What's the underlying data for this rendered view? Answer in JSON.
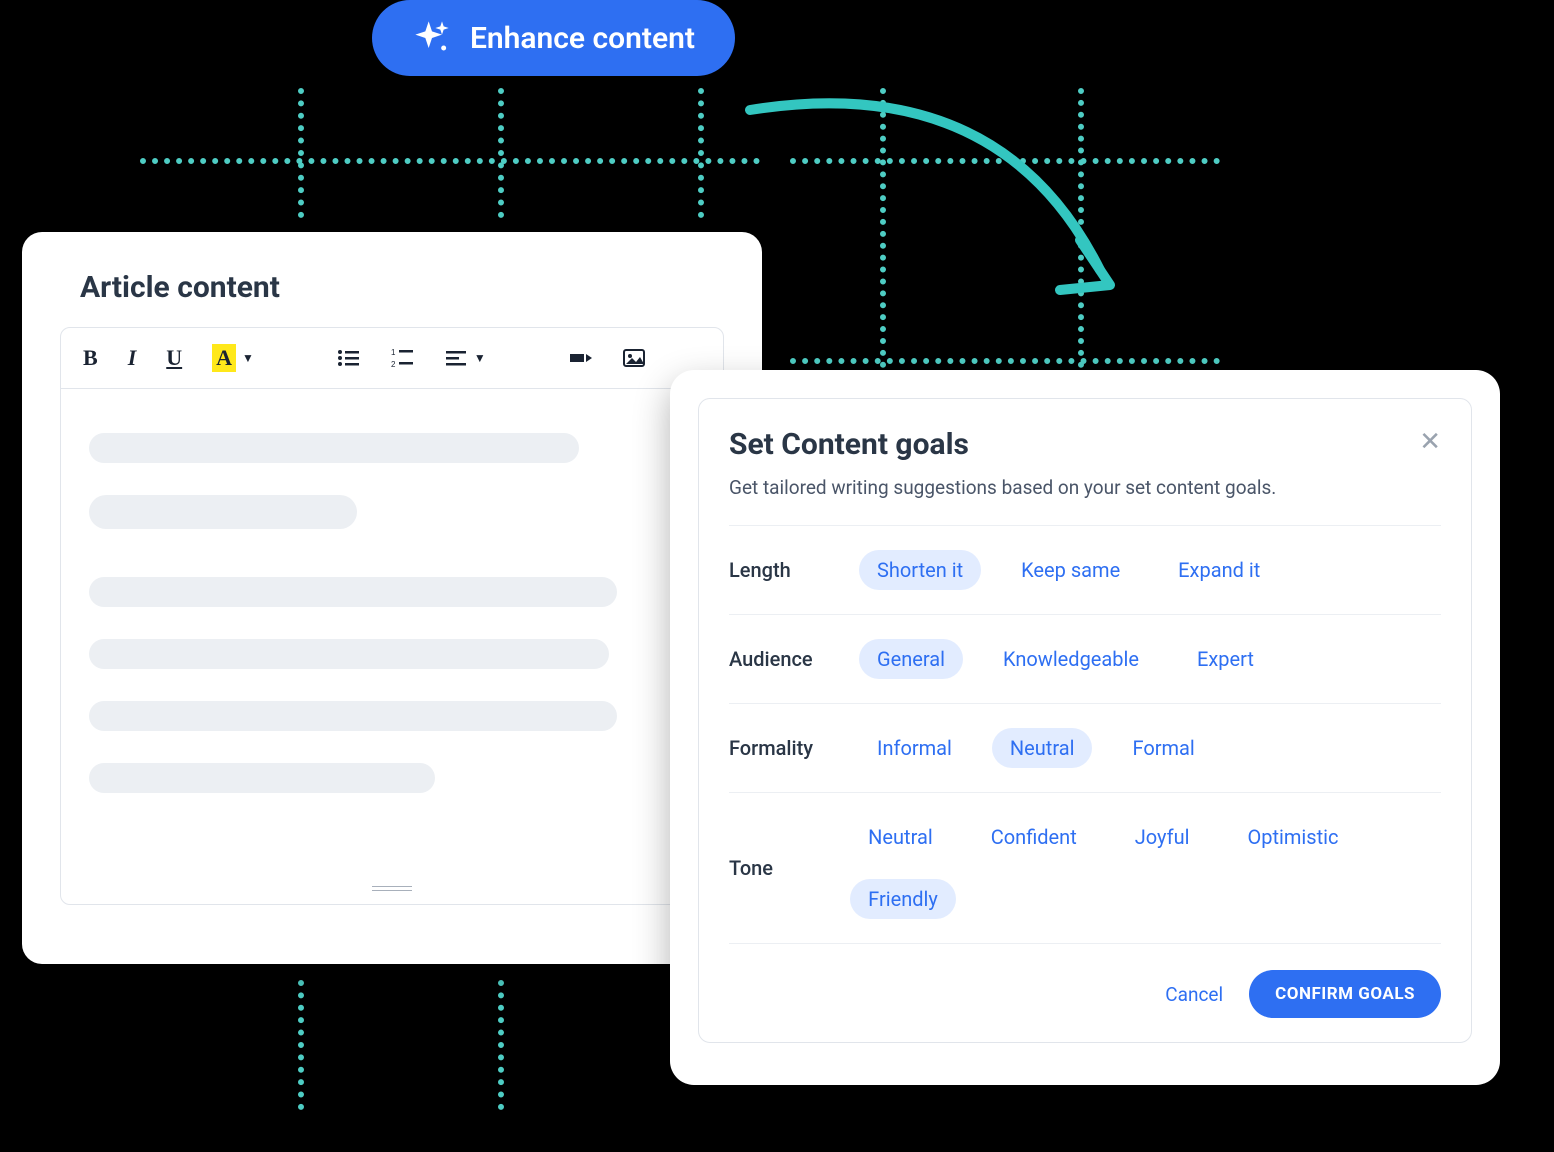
{
  "enhance": {
    "label": "Enhance content"
  },
  "article": {
    "title": "Article content"
  },
  "goals": {
    "title": "Set Content goals",
    "subtitle": "Get tailored writing suggestions based on your set content goals.",
    "rows": [
      {
        "label": "Length",
        "options": [
          "Shorten it",
          "Keep same",
          "Expand it"
        ],
        "selected": "Shorten it"
      },
      {
        "label": "Audience",
        "options": [
          "General",
          "Knowledgeable",
          "Expert"
        ],
        "selected": "General"
      },
      {
        "label": "Formality",
        "options": [
          "Informal",
          "Neutral",
          "Formal"
        ],
        "selected": "Neutral"
      },
      {
        "label": "Tone",
        "options": [
          "Neutral",
          "Confident",
          "Joyful",
          "Optimistic",
          "Friendly"
        ],
        "selected": "Friendly"
      }
    ],
    "cancel": "Cancel",
    "confirm": "CONFIRM GOALS"
  }
}
